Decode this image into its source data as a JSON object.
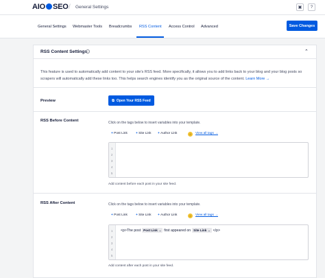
{
  "header": {
    "logo_left": "AIO",
    "logo_right": "SEO",
    "title": "General Settings",
    "icons": [
      "notifications-icon",
      "help-icon"
    ]
  },
  "tabs": [
    {
      "label": "General Settings"
    },
    {
      "label": "Webmaster Tools"
    },
    {
      "label": "Breadcrumbs"
    },
    {
      "label": "RSS Content",
      "active": true
    },
    {
      "label": "Access Control"
    },
    {
      "label": "Advanced"
    }
  ],
  "save_button": "Save Changes",
  "card": {
    "title": "RSS Content Settings",
    "description": "This feature is used to automatically add content to your site's RSS feed. More specifically, it allows you to add links back to your blog and your blog posts so scrapers will automatically add these links too. This helps search engines identify you as the original source of the content.",
    "learn_more": "Learn More →",
    "preview_label": "Preview",
    "preview_button": "Open Your RSS Feed",
    "before": {
      "label": "RSS Before Content",
      "hint": "Click on the tags below to insert variables into your template.",
      "tags": [
        "Post Link",
        "Site Link",
        "Author Link"
      ],
      "view_all": "View all tags →",
      "line_numbers": [
        "1",
        "2",
        "3",
        "4",
        "5"
      ],
      "help": "Add content before each post in your site feed."
    },
    "after": {
      "label": "RSS After Content",
      "hint": "Click on the tags below to insert variables into your template.",
      "tags": [
        "Post Link",
        "Site Link",
        "Author Link"
      ],
      "view_all": "View all tags →",
      "line_numbers": [
        "1",
        "2",
        "3",
        "4",
        "5"
      ],
      "code_prefix": "<p>The post",
      "chip1": "Post Link",
      "code_middle": "first appeared on",
      "chip2": "Site Link",
      "code_suffix": "</p>",
      "help": "Add content after each post in your site feed."
    }
  },
  "colors": {
    "accent": "#005ae0",
    "text": "#141b38",
    "muted": "#434960"
  }
}
